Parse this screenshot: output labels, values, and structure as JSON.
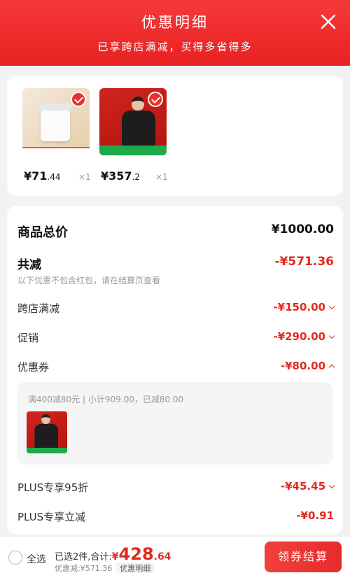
{
  "header": {
    "title": "优惠明细",
    "subtitle": "已享跨店满减，买得多省得多"
  },
  "products": [
    {
      "price_int": "¥71",
      "price_dec": ".44",
      "qty": "×1"
    },
    {
      "price_int": "¥357",
      "price_dec": ".2",
      "qty": "×1"
    }
  ],
  "detail": {
    "total_label": "商品总价",
    "total_value": "¥1000.00",
    "saved_label": "共减",
    "saved_value": "-¥571.36",
    "note": "以下优惠不包含红包，请在结算页查看",
    "rows": [
      {
        "label": "跨店满减",
        "value": "-¥150.00"
      },
      {
        "label": "促销",
        "value": "-¥290.00"
      },
      {
        "label": "优惠券",
        "value": "-¥80.00"
      },
      {
        "label": "PLUS专享95折",
        "value": "-¥45.45"
      },
      {
        "label": "PLUS专享立减",
        "value": "-¥0.91"
      }
    ],
    "coupon_text": "满400减80元 | 小计909.00，已减80.00"
  },
  "bottom": {
    "select_all": "全选",
    "summary_prefix": "已选2件,合计:",
    "currency": "¥",
    "amount_int": "428",
    "amount_dec": ".64",
    "discount_text": "优惠减:¥571.36",
    "detail_tag": "优惠明细",
    "checkout_label": "领券结算"
  },
  "colors": {
    "accent": "#e4291e",
    "header": "#ee2a2a",
    "success": "#1ea94a"
  },
  "icons": [
    "close-icon",
    "check-icon",
    "chevron-down-icon",
    "chevron-up-icon",
    "radio-icon"
  ]
}
